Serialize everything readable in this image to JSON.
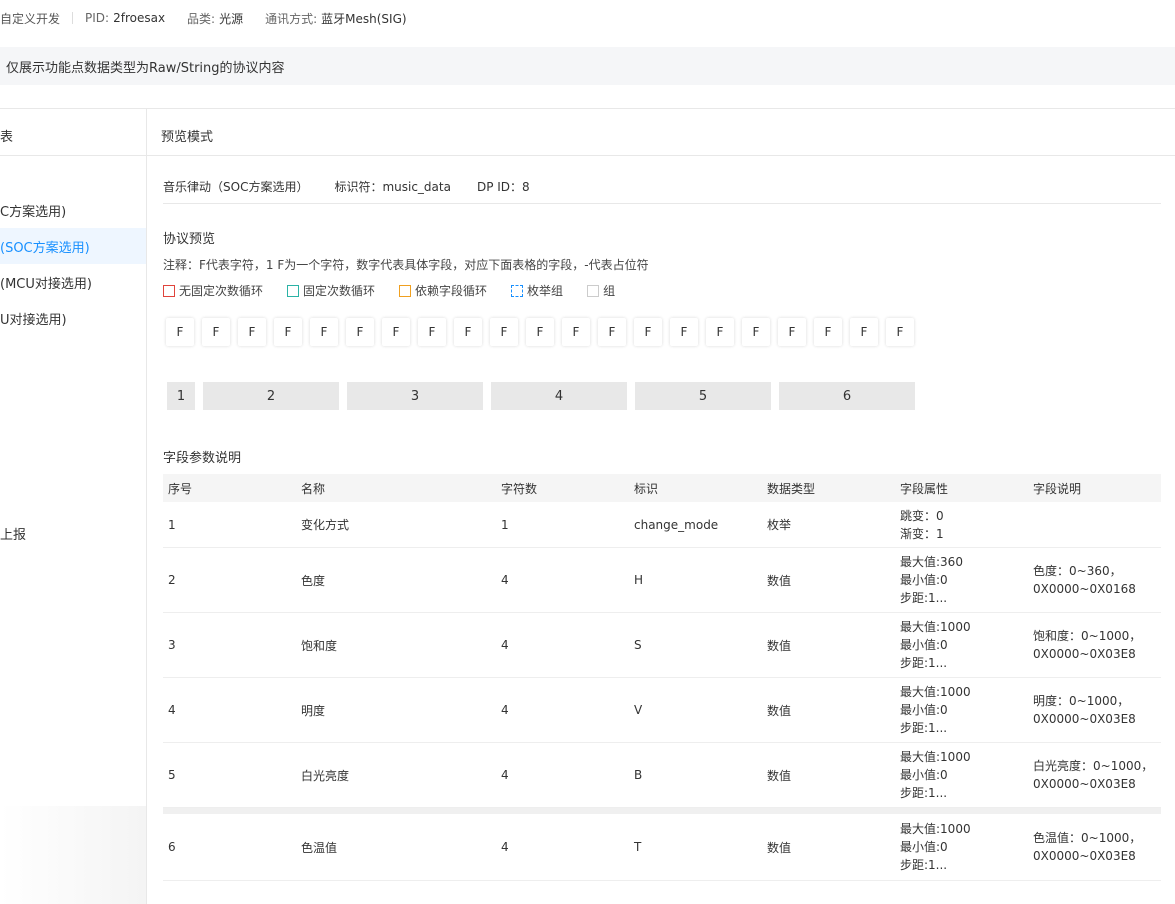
{
  "topbar": {
    "type_text": "自定义开发",
    "pid_label": "PID:",
    "pid_value": "2froesax",
    "category_label": "品类:",
    "category_value": "光源",
    "comm_label": "通讯方式:",
    "comm_value": "蓝牙Mesh(SIG)"
  },
  "notice": "仅展示功能点数据类型为Raw/String的协议内容",
  "left_header": "表",
  "right_header": "预览模式",
  "sidebar": {
    "items": [
      {
        "label": "C方案选用)",
        "active": false
      },
      {
        "label": "(SOC方案选用)",
        "active": true
      },
      {
        "label": "(MCU对接选用)",
        "active": false
      },
      {
        "label": "U对接选用)",
        "active": false
      }
    ],
    "report": "上报"
  },
  "dp": {
    "name": "音乐律动（SOC方案选用）",
    "identifier": "标识符：music_data",
    "dp_id": "DP ID：8"
  },
  "preview": {
    "title": "协议预览",
    "note": "注释：F代表字符，1 F为一个字符，数字代表具体字段，对应下面表格的字段，-代表占位符",
    "legend": [
      {
        "label": "无固定次数循环",
        "color": "#e0443c",
        "style": "solid"
      },
      {
        "label": "固定次数循环",
        "color": "#2bb3a6",
        "style": "solid"
      },
      {
        "label": "依赖字段循环",
        "color": "#f0a020",
        "style": "solid"
      },
      {
        "label": "枚举组",
        "color": "#1890ff",
        "style": "dashed"
      },
      {
        "label": "组",
        "color": "#cccccc",
        "style": "solid"
      }
    ],
    "chars": [
      "F",
      "F",
      "F",
      "F",
      "F",
      "F",
      "F",
      "F",
      "F",
      "F",
      "F",
      "F",
      "F",
      "F",
      "F",
      "F",
      "F",
      "F",
      "F",
      "F",
      "F"
    ],
    "fields": [
      "1",
      "2",
      "3",
      "4",
      "5",
      "6"
    ]
  },
  "fields_table": {
    "title": "字段参数说明",
    "headers": [
      "序号",
      "名称",
      "字符数",
      "标识",
      "数据类型",
      "字段属性",
      "字段说明"
    ],
    "rows": [
      {
        "no": "1",
        "name": "变化方式",
        "chars": "1",
        "id": "change_mode",
        "type": "枚举",
        "attrs": [
          "跳变：0",
          "渐变：1"
        ],
        "desc": []
      },
      {
        "no": "2",
        "name": "色度",
        "chars": "4",
        "id": "H",
        "type": "数值",
        "attrs": [
          "最大值:360",
          "最小值:0",
          "步距:1..."
        ],
        "desc": [
          "色度：0~360，",
          "0X0000~0X0168"
        ]
      },
      {
        "no": "3",
        "name": "饱和度",
        "chars": "4",
        "id": "S",
        "type": "数值",
        "attrs": [
          "最大值:1000",
          "最小值:0",
          "步距:1..."
        ],
        "desc": [
          "饱和度：0~1000，",
          "0X0000~0X03E8"
        ]
      },
      {
        "no": "4",
        "name": "明度",
        "chars": "4",
        "id": "V",
        "type": "数值",
        "attrs": [
          "最大值:1000",
          "最小值:0",
          "步距:1..."
        ],
        "desc": [
          "明度：0~1000，",
          "0X0000~0X03E8"
        ]
      },
      {
        "no": "5",
        "name": "白光亮度",
        "chars": "4",
        "id": "B",
        "type": "数值",
        "attrs": [
          "最大值:1000",
          "最小值:0",
          "步距:1..."
        ],
        "desc": [
          "白光亮度：0~1000，",
          "0X0000~0X03E8"
        ]
      },
      {
        "no": "6",
        "name": "色温值",
        "chars": "4",
        "id": "T",
        "type": "数值",
        "attrs": [
          "最大值:1000",
          "最小值:0",
          "步距:1..."
        ],
        "desc": [
          "色温值：0~1000，",
          "0X0000~0X03E8"
        ]
      }
    ]
  }
}
